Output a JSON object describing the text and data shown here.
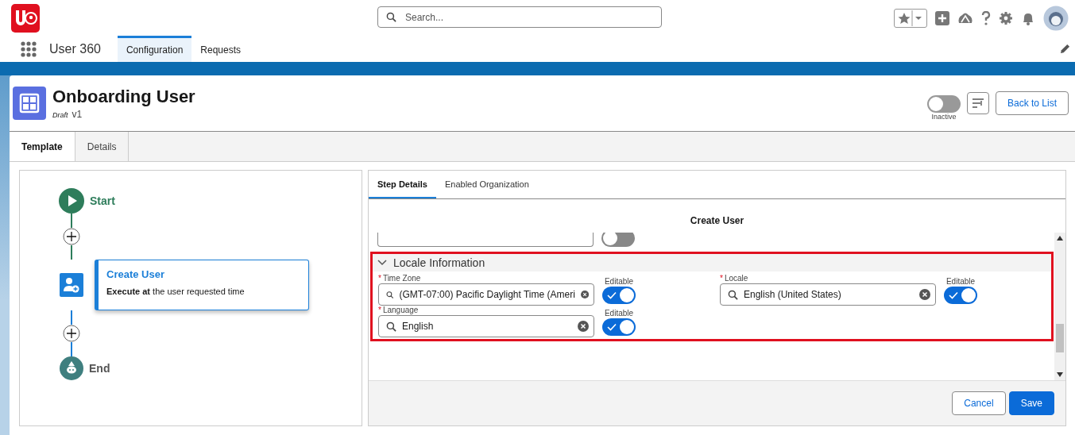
{
  "app": {
    "name": "User 360"
  },
  "search": {
    "placeholder": "Search..."
  },
  "nav_tabs": [
    {
      "label": "Configuration",
      "selected": true
    },
    {
      "label": "Requests",
      "selected": false
    }
  ],
  "record": {
    "title": "Onboarding User",
    "status": "Draft",
    "version": "v1",
    "toggle": {
      "on": false,
      "label": "Inactive"
    },
    "back_button": "Back to List"
  },
  "record_tabs": [
    {
      "label": "Template",
      "selected": true
    },
    {
      "label": "Details",
      "selected": false
    }
  ],
  "flow": {
    "start": "Start",
    "step": {
      "title": "Create User",
      "description": "**Execute at** the user requested time"
    },
    "end": "End"
  },
  "detail_tabs": [
    {
      "label": "Step Details",
      "selected": true
    },
    {
      "label": "Enabled Organization",
      "selected": false
    }
  ],
  "step_title": "Create User",
  "partial_row": {
    "editable": false
  },
  "section": {
    "title": "Locale Information",
    "expanded": true,
    "highlighted": true,
    "fields": [
      {
        "label": "Time Zone",
        "required_mark": "*",
        "value": "(GMT-07:00) Pacific Daylight Time (Ameri",
        "editable_label": "Editable",
        "editable": true
      },
      {
        "label": "Locale",
        "required_mark": "*",
        "value": "English (United States)",
        "editable_label": "Editable",
        "editable": true
      },
      {
        "label": "Language",
        "required_mark": "*",
        "value": "English",
        "editable_label": "Editable",
        "editable": true
      }
    ]
  },
  "buttons": {
    "cancel": "Cancel",
    "save": "Save"
  }
}
